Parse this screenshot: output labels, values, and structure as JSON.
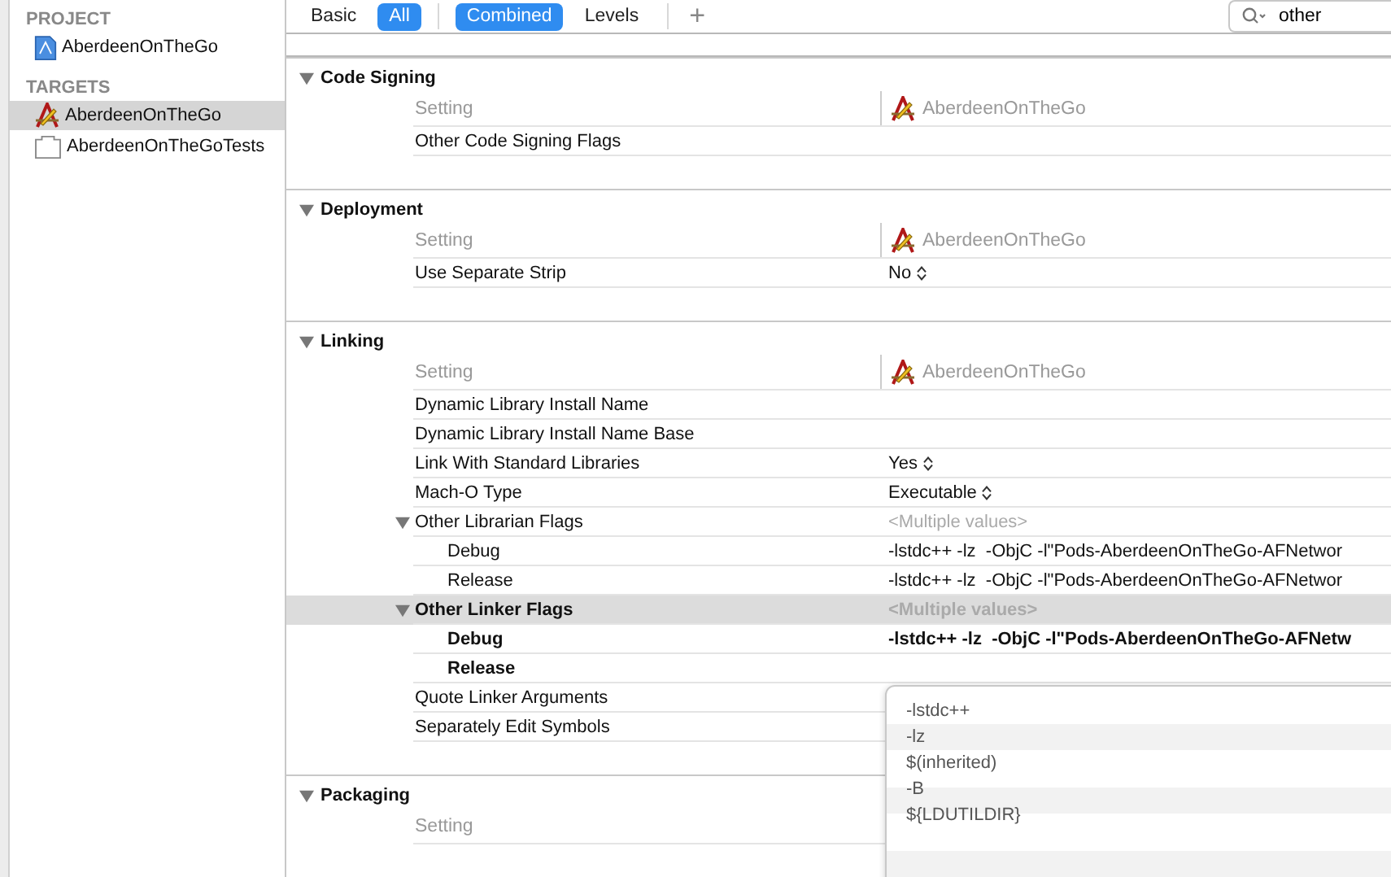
{
  "sidebar": {
    "sections": [
      {
        "title": "PROJECT",
        "items": [
          {
            "label": "AberdeenOnTheGo",
            "kind": "project",
            "selected": false
          }
        ]
      },
      {
        "title": "TARGETS",
        "items": [
          {
            "label": "AberdeenOnTheGo",
            "kind": "app",
            "selected": true
          },
          {
            "label": "AberdeenOnTheGoTests",
            "kind": "tests",
            "selected": false
          }
        ]
      }
    ]
  },
  "toolbar": {
    "filters": [
      {
        "label": "Basic",
        "selected": false
      },
      {
        "label": "All",
        "selected": true
      }
    ],
    "modes": [
      {
        "label": "Combined",
        "selected": true
      },
      {
        "label": "Levels",
        "selected": false
      }
    ],
    "add_label": "+",
    "search": {
      "value": "other"
    }
  },
  "sections": [
    {
      "title": "Code Signing",
      "expanded": true,
      "header": {
        "setting": "Setting",
        "target": "AberdeenOnTheGo"
      },
      "rows": [
        {
          "name": "Other Code Signing Flags",
          "kind": "plain",
          "customized": false,
          "selected": false
        }
      ]
    },
    {
      "title": "Deployment",
      "expanded": true,
      "header": {
        "setting": "Setting",
        "target": "AberdeenOnTheGo"
      },
      "rows": [
        {
          "name": "Use Separate Strip",
          "kind": "popup",
          "value": "No",
          "customized": false,
          "selected": false
        }
      ]
    },
    {
      "title": "Linking",
      "expanded": true,
      "header": {
        "setting": "Setting",
        "target": "AberdeenOnTheGo"
      },
      "rows": [
        {
          "name": "Dynamic Library Install Name",
          "kind": "plain",
          "customized": false,
          "selected": false
        },
        {
          "name": "Dynamic Library Install Name Base",
          "kind": "plain",
          "customized": false,
          "selected": false
        },
        {
          "name": "Link With Standard Libraries",
          "kind": "popup",
          "value": "Yes",
          "customized": false,
          "selected": false
        },
        {
          "name": "Mach-O Type",
          "kind": "popup",
          "value": "Executable",
          "customized": false,
          "selected": false
        },
        {
          "name": "Other Librarian Flags",
          "kind": "group",
          "value": "<Multiple values>",
          "expanded": true,
          "customized": false,
          "selected": false,
          "children": [
            {
              "name": "Debug",
              "value": "-lstdc++ -lz  -ObjC -l\"Pods-AberdeenOnTheGo-AFNetwor",
              "customized": false
            },
            {
              "name": "Release",
              "value": "-lstdc++ -lz  -ObjC -l\"Pods-AberdeenOnTheGo-AFNetwor",
              "customized": false
            }
          ]
        },
        {
          "name": "Other Linker Flags",
          "kind": "group",
          "value": "<Multiple values>",
          "expanded": true,
          "customized": true,
          "selected": true,
          "children": [
            {
              "name": "Debug",
              "value": "-lstdc++ -lz  -ObjC -l\"Pods-AberdeenOnTheGo-AFNetw",
              "customized": true
            },
            {
              "name": "Release",
              "customized": true
            }
          ]
        },
        {
          "name": "Quote Linker Arguments",
          "kind": "plain",
          "customized": false,
          "selected": false
        },
        {
          "name": "Separately Edit Symbols",
          "kind": "plain",
          "customized": false,
          "selected": false
        }
      ]
    },
    {
      "title": "Packaging",
      "expanded": true,
      "header": {
        "setting": "Setting"
      }
    }
  ],
  "editor": {
    "items": [
      "-lstdc++",
      "-lz",
      "$(inherited)",
      "-B",
      "${LDUTILDIR}"
    ]
  }
}
